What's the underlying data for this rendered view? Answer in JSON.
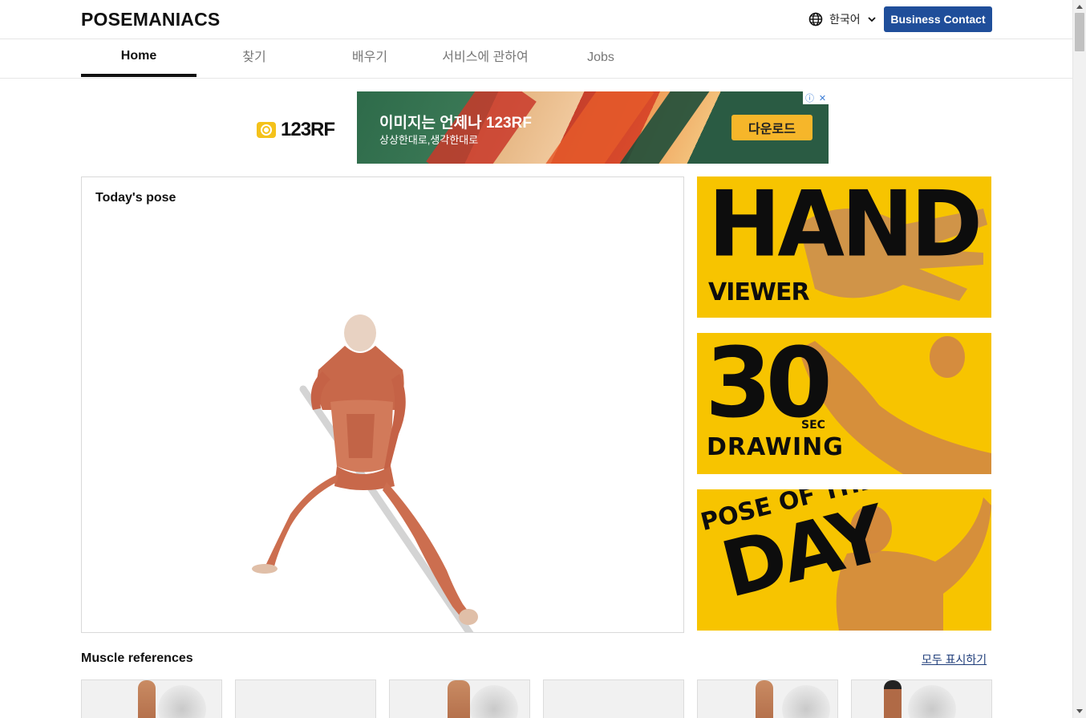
{
  "header": {
    "logo": "POSEMANIACS",
    "language": "한국어",
    "language_icon": "globe-icon",
    "business_contact": "Business Contact"
  },
  "nav": {
    "tabs": [
      {
        "label": "Home",
        "active": true
      },
      {
        "label": "찾기",
        "active": false
      },
      {
        "label": "배우기",
        "active": false
      },
      {
        "label": "서비스에 관하여",
        "active": false
      },
      {
        "label": "Jobs",
        "active": false
      }
    ]
  },
  "ad": {
    "brand": "123RF",
    "title": "이미지는 언제나 123RF",
    "subtitle": "상상한대로,생각한대로",
    "cta": "다운로드",
    "info_icon": "info-icon",
    "close_icon": "close-icon"
  },
  "today_pose": {
    "title": "Today's pose"
  },
  "promos": {
    "hand": {
      "big": "HAND",
      "small": "VIEWER"
    },
    "thirty": {
      "big": "30",
      "sec": "SEC",
      "drawing": "DRAWING"
    },
    "day": {
      "top": "POSE OF THE",
      "big": "DAY"
    }
  },
  "muscle_references": {
    "title": "Muscle references",
    "show_all": "모두 표시하기",
    "count": 6
  },
  "colors": {
    "accent": "#1f4e9a",
    "promo_yellow": "#f7c400",
    "link": "#1f3d7a"
  }
}
